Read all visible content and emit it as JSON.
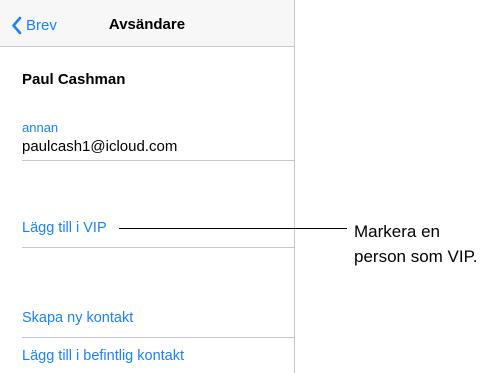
{
  "navbar": {
    "back_label": "Brev",
    "title": "Avsändare"
  },
  "contact": {
    "name": "Paul Cashman",
    "email_label": "annan",
    "email": "paulcash1@icloud.com"
  },
  "actions": {
    "add_vip": "Lägg till i VIP",
    "create_contact": "Skapa ny kontakt",
    "add_existing": "Lägg till i befintlig kontakt"
  },
  "callout": {
    "line1": "Markera en",
    "line2": "person som VIP."
  },
  "colors": {
    "accent": "#1a82fb",
    "separator": "#c8c7cc",
    "navbar_bg": "#f7f7f7"
  },
  "icons": {
    "back": "chevron-left-icon"
  }
}
